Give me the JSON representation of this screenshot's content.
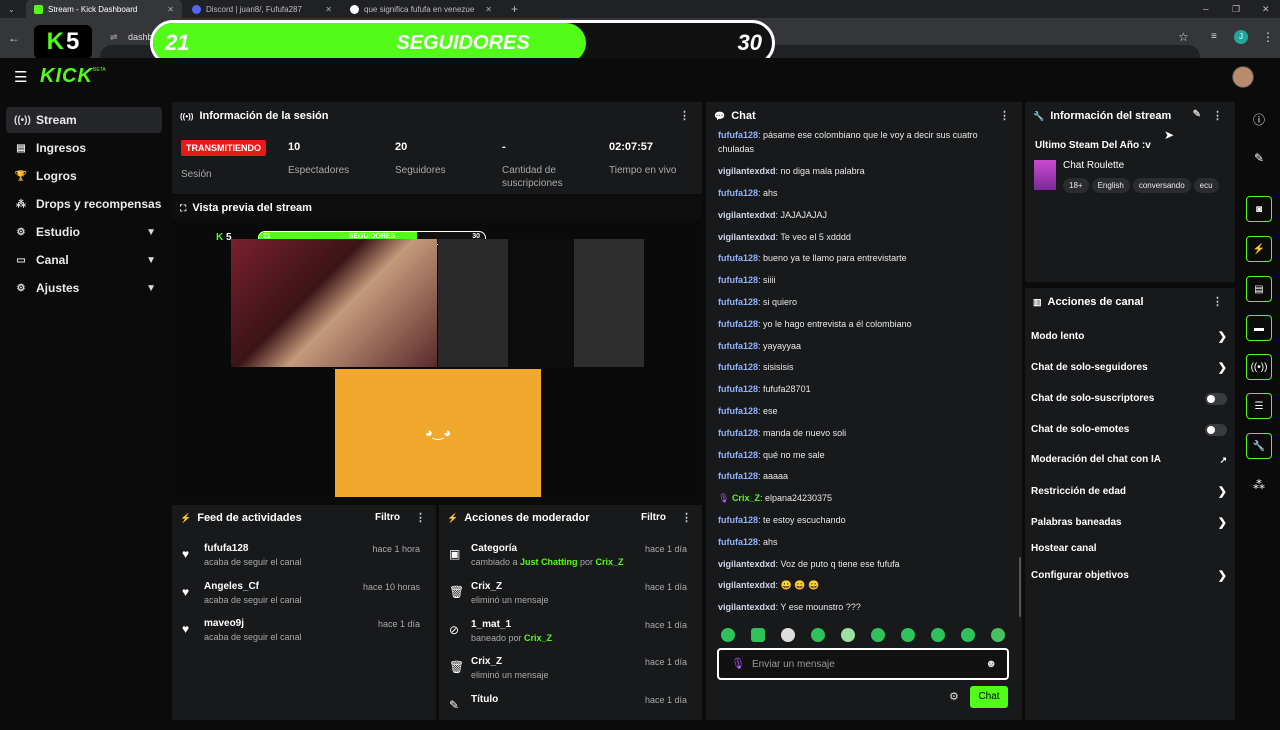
{
  "browser": {
    "tabs": [
      {
        "title": "Stream - Kick Dashboard"
      },
      {
        "title": "Discord | juan8/, Fufufa287"
      },
      {
        "title": "que significa fufufa en venezue"
      }
    ],
    "url_partial": "dashb"
  },
  "overlay": {
    "logo_letters": "K",
    "logo_number": "5",
    "followers_current": "21",
    "goal_label": "SEGUIDORES",
    "followers_goal": "30",
    "progress": 0.7
  },
  "header": {
    "logo": "KICK",
    "logo_sup": "BETA"
  },
  "sidebar": {
    "items": [
      {
        "label": "Stream",
        "icon": "broadcast-icon"
      },
      {
        "label": "Ingresos",
        "icon": "wallet-icon"
      },
      {
        "label": "Logros",
        "icon": "trophy-icon"
      },
      {
        "label": "Drops y recompensas",
        "icon": "gift-icon"
      },
      {
        "label": "Estudio",
        "icon": "gear-icon"
      },
      {
        "label": "Canal",
        "icon": "channel-icon"
      },
      {
        "label": "Ajustes",
        "icon": "settings-icon"
      }
    ]
  },
  "session": {
    "title": "Información de la sesión",
    "status_badge": "TRANSMITIENDO",
    "status_label": "Sesión",
    "viewers_value": "10",
    "viewers_label": "Espectadores",
    "followers_value": "20",
    "followers_label": "Seguidores",
    "subs_value": "-",
    "subs_label": "Cantidad de suscripciones",
    "time_value": "02:07:57",
    "time_label": "Tiempo en vivo"
  },
  "preview": {
    "title": "Vista previa del stream",
    "mini_banner_left": "21",
    "mini_banner_label": "SEGUIDORES",
    "mini_banner_right": "30"
  },
  "feed": {
    "title": "Feed de actividades",
    "filter": "Filtro",
    "items": [
      {
        "name": "fufufa128",
        "sub": "acaba de seguir el canal",
        "time": "hace 1 hora"
      },
      {
        "name": "Angeles_Cf",
        "sub": "acaba de seguir el canal",
        "time": "hace 10 horas"
      },
      {
        "name": "maveo9j",
        "sub": "acaba de seguir el canal",
        "time": "hace 1 día"
      }
    ]
  },
  "mod": {
    "title": "Acciones de moderador",
    "filter": "Filtro",
    "items": [
      {
        "name": "Categoría",
        "sub1": "cambiado a ",
        "sub_hl": "Just Chatting",
        "sub2": " por ",
        "sub_user": "Crix_Z",
        "time": "hace 1 día"
      },
      {
        "name": "Crix_Z",
        "sub1": "eliminó un mensaje",
        "time": "hace 1 día"
      },
      {
        "name": "1_mat_1",
        "sub1": "baneado por ",
        "sub_user": "Crix_Z",
        "time": "hace 1 día"
      },
      {
        "name": "Crix_Z",
        "sub1": "eliminó un mensaje",
        "time": "hace 1 día"
      },
      {
        "name": "Título",
        "time": "hace 1 día"
      }
    ]
  },
  "chat": {
    "title": "Chat",
    "messages": [
      {
        "user": "fufufa128",
        "text": "pásame ese colombiano que le voy a decir sus cuatro chuladas"
      },
      {
        "user": "vigilantexdxd",
        "text": "no diga mala palabra"
      },
      {
        "user": "fufufa128",
        "text": "ahs"
      },
      {
        "user": "vigilantexdxd",
        "text": "JAJAJAJAJ"
      },
      {
        "user": "vigilantexdxd",
        "text": "Te veo el 5 xdddd"
      },
      {
        "user": "fufufa128",
        "text": "bueno ya te llamo para entrevistarte"
      },
      {
        "user": "fufufa128",
        "text": "siiii"
      },
      {
        "user": "fufufa128",
        "text": "si quiero"
      },
      {
        "user": "fufufa128",
        "text": "yo le hago entrevista a él colombiano"
      },
      {
        "user": "fufufa128",
        "text": "yayayyaa"
      },
      {
        "user": "fufufa128",
        "text": "sisisisis"
      },
      {
        "user": "fufufa128",
        "text": "fufufa28701"
      },
      {
        "user": "fufufa128",
        "text": "ese"
      },
      {
        "user": "fufufa128",
        "text": "manda de nuevo soli"
      },
      {
        "user": "fufufa128",
        "text": "qué no me sale"
      },
      {
        "user": "fufufa128",
        "text": "aaaaa"
      },
      {
        "user": "Crix_Z",
        "text": "elpana24230375"
      },
      {
        "user": "fufufa128",
        "text": "te estoy escuchando"
      },
      {
        "user": "fufufa128",
        "text": "ahs"
      },
      {
        "user": "vigilantexdxd",
        "text": "Voz de puto q tiene ese fufufa"
      },
      {
        "user": "vigilantexdxd",
        "text": "😀 😀 😀"
      },
      {
        "user": "vigilantexdxd",
        "text": "Y ese mounstro ???"
      }
    ],
    "input_placeholder": "Enviar un mensaje",
    "send_label": "Chat"
  },
  "stream_info": {
    "title": "Información del stream",
    "stream_title": "Ultimo Steam Del Año :v",
    "category": "Chat Roulette",
    "tags": [
      "18+",
      "English",
      "conversando",
      "ecu"
    ]
  },
  "channel_actions": {
    "title": "Acciones de canal",
    "items": [
      {
        "label": "Modo lento",
        "control": "chevron"
      },
      {
        "label": "Chat de solo-seguidores",
        "control": "chevron"
      },
      {
        "label": "Chat de solo-suscriptores",
        "control": "toggle"
      },
      {
        "label": "Chat de solo-emotes",
        "control": "toggle"
      },
      {
        "label": "Moderación del chat con IA",
        "control": "external"
      },
      {
        "label": "Restricción de edad",
        "control": "chevron"
      },
      {
        "label": "Palabras baneadas",
        "control": "chevron"
      },
      {
        "label": "Hostear canal",
        "control": "none"
      },
      {
        "label": "Configurar objetivos",
        "control": "chevron"
      }
    ]
  },
  "colors": {
    "accent": "#53fc18",
    "live": "#e91916",
    "panel": "#18191b",
    "bg": "#0b0b0c"
  }
}
